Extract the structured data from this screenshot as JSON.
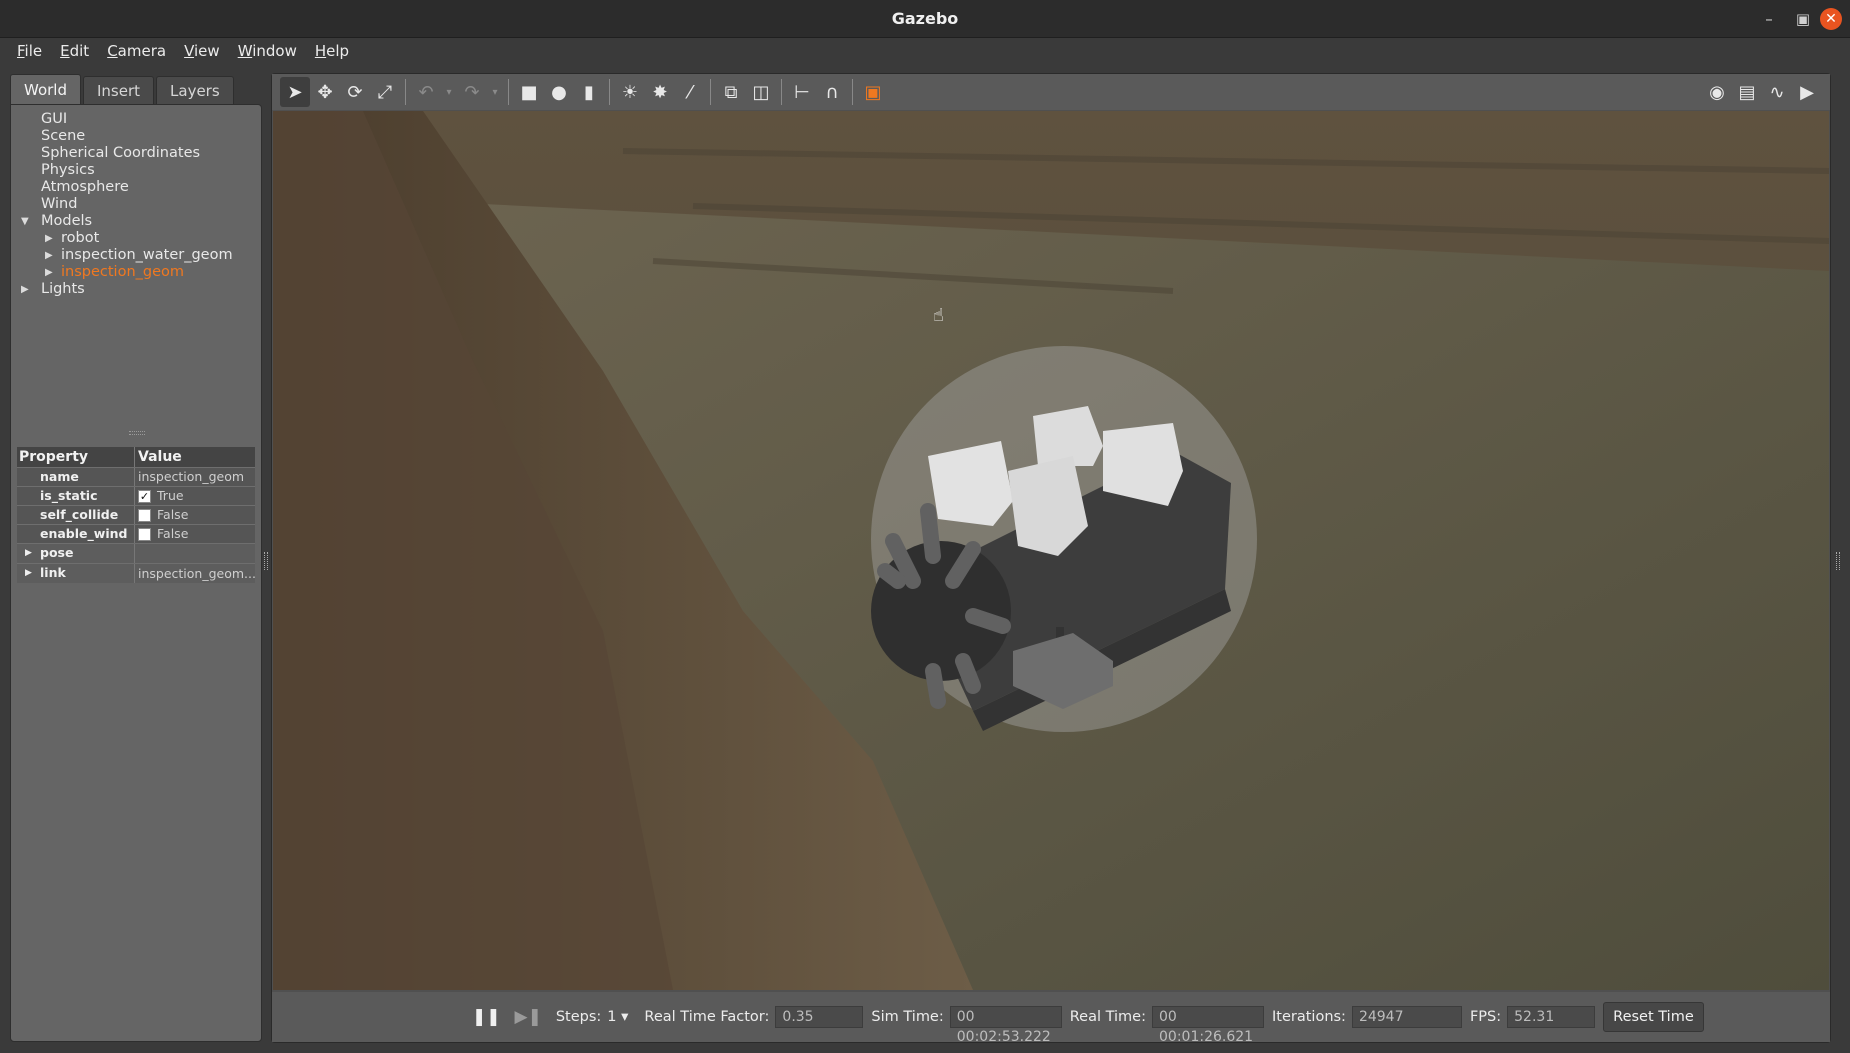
{
  "window": {
    "title": "Gazebo",
    "minimize_icon": "minimize-icon",
    "maximize_icon": "maximize-icon",
    "close_icon": "close-icon",
    "close_color": "#e95420"
  },
  "menu": [
    {
      "label": "File",
      "underline": "F",
      "rest": "ile"
    },
    {
      "label": "Edit",
      "underline": "E",
      "rest": "dit"
    },
    {
      "label": "Camera",
      "underline": "C",
      "rest": "amera"
    },
    {
      "label": "View",
      "underline": "V",
      "rest": "iew"
    },
    {
      "label": "Window",
      "underline": "W",
      "rest": "indow"
    },
    {
      "label": "Help",
      "underline": "H",
      "rest": "elp"
    }
  ],
  "left_panel": {
    "tabs": [
      {
        "label": "World",
        "active": true
      },
      {
        "label": "Insert",
        "active": false
      },
      {
        "label": "Layers",
        "active": false
      }
    ],
    "tree": {
      "gui": "GUI",
      "scene": "Scene",
      "spherical": "Spherical Coordinates",
      "physics": "Physics",
      "atmosphere": "Atmosphere",
      "wind": "Wind",
      "models": "Models",
      "models_children": [
        "robot",
        "inspection_water_geom",
        "inspection_geom"
      ],
      "lights": "Lights",
      "selected": "inspection_geom",
      "selected_color": "#f07820"
    },
    "properties": {
      "header_property": "Property",
      "header_value": "Value",
      "name_key": "name",
      "name_value": "inspection_geom",
      "is_static_key": "is_static",
      "is_static_value": "True",
      "is_static_checked": true,
      "self_collide_key": "self_collide",
      "self_collide_value": "False",
      "self_collide_checked": false,
      "enable_wind_key": "enable_wind",
      "enable_wind_value": "False",
      "enable_wind_checked": false,
      "pose_key": "pose",
      "link_key": "link",
      "link_value": "inspection_geom..."
    }
  },
  "toolbar": {
    "left_icons": [
      "select-arrow-icon",
      "translate-icon",
      "rotate-icon",
      "scale-icon",
      "undo-icon",
      "redo-icon",
      "box-icon",
      "sphere-icon",
      "cylinder-icon",
      "point-light-icon",
      "spot-light-icon",
      "directional-light-icon",
      "copy-icon",
      "paste-icon",
      "align-icon",
      "snap-magnet-icon",
      "view-angle-icon"
    ],
    "right_icons": [
      "screenshot-camera-icon",
      "log-icon",
      "plot-icon",
      "record-video-icon"
    ]
  },
  "bottom_bar": {
    "steps_label": "Steps:",
    "steps_value": "1",
    "rtf_label": "Real Time Factor:",
    "rtf_value": "0.35",
    "sim_time_label": "Sim Time:",
    "sim_time_value": "00 00:02:53.222",
    "real_time_label": "Real Time:",
    "real_time_value": "00 00:01:26.621",
    "iterations_label": "Iterations:",
    "iterations_value": "24947",
    "fps_label": "FPS:",
    "fps_value": "52.31",
    "reset_label": "Reset Time"
  }
}
